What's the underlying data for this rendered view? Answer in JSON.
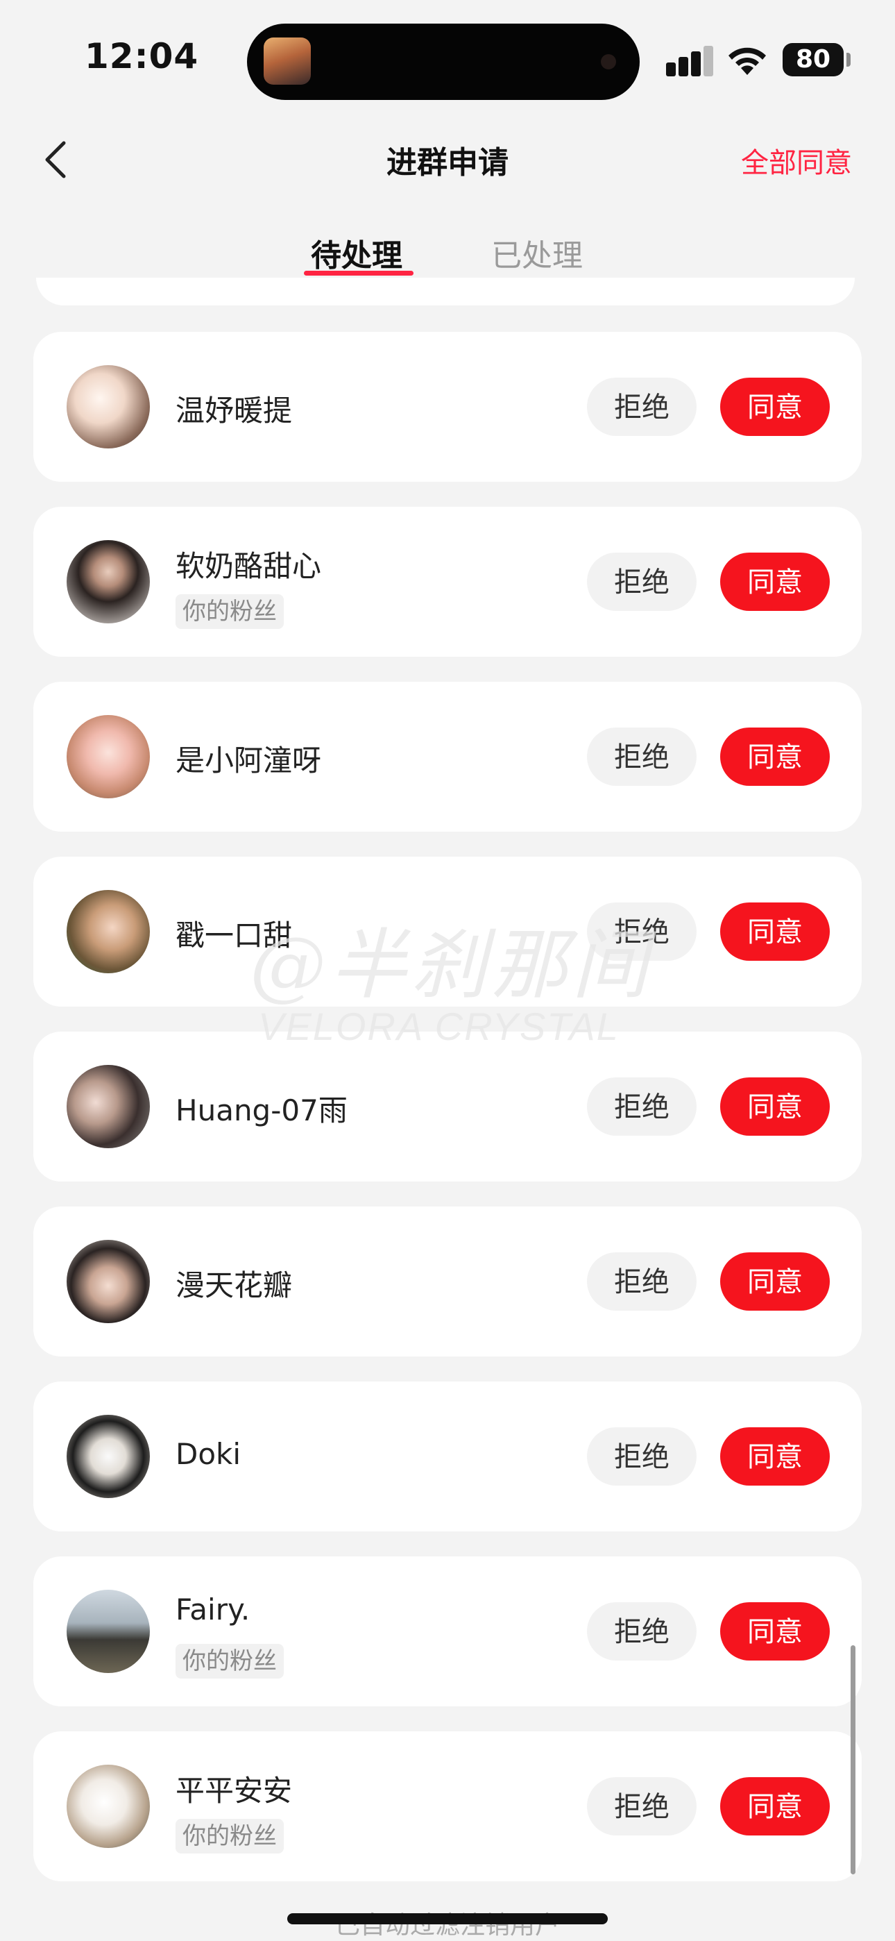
{
  "status_bar": {
    "time": "12:04",
    "battery": "80"
  },
  "nav": {
    "title": "进群申请",
    "agree_all": "全部同意"
  },
  "tabs": [
    {
      "label": "待处理"
    },
    {
      "label": "已处理"
    }
  ],
  "buttons": {
    "reject": "拒绝",
    "accept": "同意"
  },
  "applicants": [
    {
      "name": "温妤暖提",
      "badge": ""
    },
    {
      "name": "软奶酪甜心",
      "badge": "你的粉丝"
    },
    {
      "name": "是小阿潼呀",
      "badge": ""
    },
    {
      "name": "戳一口甜",
      "badge": ""
    },
    {
      "name": "Huang-07雨",
      "badge": ""
    },
    {
      "name": "漫天花瓣",
      "badge": ""
    },
    {
      "name": "Doki",
      "badge": ""
    },
    {
      "name": "Fairy.",
      "badge": "你的粉丝"
    },
    {
      "name": "平平安安",
      "badge": "你的粉丝"
    }
  ],
  "watermark": {
    "main": "@半刹那间",
    "sub": "VELORA CRYSTAL"
  },
  "footer": {
    "note": "已自动过滤注销用户"
  }
}
